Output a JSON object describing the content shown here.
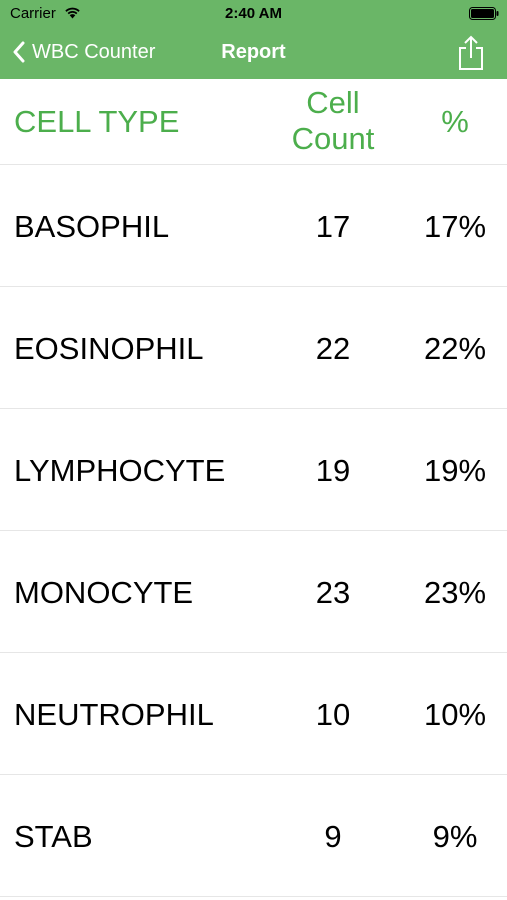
{
  "status_bar": {
    "carrier": "Carrier",
    "time": "2:40 AM"
  },
  "nav": {
    "back_label": "WBC Counter",
    "title": "Report",
    "accent_color": "#6ab667"
  },
  "table": {
    "headers": {
      "cell_type": "CELL TYPE",
      "cell_count_line1": "Cell",
      "cell_count_line2": "Count",
      "percent": "%"
    },
    "rows": [
      {
        "type": "BASOPHIL",
        "count": "17",
        "percent": "17%"
      },
      {
        "type": "EOSINOPHIL",
        "count": "22",
        "percent": "22%"
      },
      {
        "type": "LYMPHOCYTE",
        "count": "19",
        "percent": "19%"
      },
      {
        "type": "MONOCYTE",
        "count": "23",
        "percent": "23%"
      },
      {
        "type": "NEUTROPHIL",
        "count": "10",
        "percent": "10%"
      },
      {
        "type": "STAB",
        "count": "9",
        "percent": "9%"
      }
    ]
  },
  "icons": {
    "wifi": "wifi-icon",
    "battery": "battery-icon",
    "back": "chevron-left-icon",
    "share": "share-icon"
  }
}
